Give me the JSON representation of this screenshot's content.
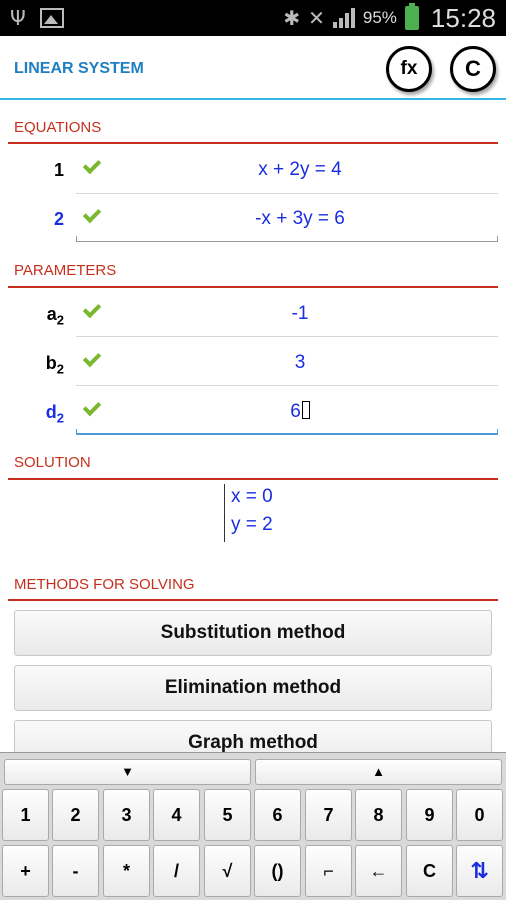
{
  "status_bar": {
    "usb_icon": "usb-icon",
    "image_icon": "image-icon",
    "bluetooth_icon": "bluetooth-icon",
    "mute_icon": "mute-icon",
    "battery_percent": "95%",
    "time": "15:28"
  },
  "header": {
    "title": "LINEAR SYSTEM",
    "fx_label": "fx",
    "clear_label": "C"
  },
  "equations": {
    "title": "EQUATIONS",
    "rows": [
      {
        "index": "1",
        "value": "x + 2y = 4"
      },
      {
        "index": "2",
        "value": "-x + 3y = 6"
      }
    ]
  },
  "parameters": {
    "title": "PARAMETERS",
    "rows": [
      {
        "name": "a",
        "sub": "2",
        "value": "-1"
      },
      {
        "name": "b",
        "sub": "2",
        "value": "3"
      },
      {
        "name": "d",
        "sub": "2",
        "value": "6"
      }
    ]
  },
  "solution": {
    "title": "SOLUTION",
    "lines": [
      "x = 0",
      "y = 2"
    ]
  },
  "methods": {
    "title": "METHODS FOR SOLVING",
    "buttons": [
      "Substitution method",
      "Elimination method",
      "Graph method"
    ]
  },
  "keyboard": {
    "down": "▼",
    "up": "▲",
    "row1": [
      "1",
      "2",
      "3",
      "4",
      "5",
      "6",
      "7",
      "8",
      "9",
      "0"
    ],
    "row2": [
      "+",
      "-",
      "*",
      "/",
      "√",
      "()",
      "⌐",
      "←",
      "C",
      "⇅"
    ]
  },
  "colors": {
    "accent_blue": "#1a2ee0",
    "section_red": "#c4301c",
    "check_green": "#7cb82f",
    "header_rule": "#33b5e5"
  }
}
